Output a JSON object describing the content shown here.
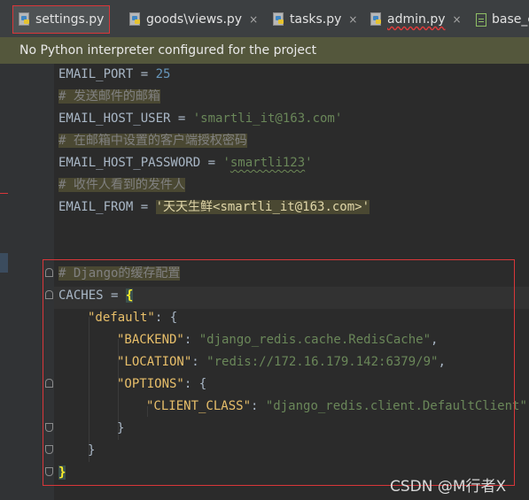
{
  "tabs": [
    {
      "label": "settings.py",
      "active": true,
      "close": ""
    },
    {
      "label": "goods\\views.py",
      "active": false,
      "close": "×"
    },
    {
      "label": "tasks.py",
      "active": false,
      "close": "×"
    },
    {
      "label": "admin.py",
      "active": false,
      "close": "×"
    },
    {
      "label": "base_c",
      "active": false,
      "close": ""
    }
  ],
  "banner": {
    "text": "No Python interpreter configured for the project"
  },
  "code": {
    "email_port_name": "EMAIL_PORT = ",
    "email_port_value": "25",
    "comment1": "# 发送邮件的邮箱",
    "email_host_user_name": "EMAIL_HOST_USER = ",
    "email_host_user_value": "'smartli_it@163.com'",
    "comment2": "# 在邮箱中设置的客户端授权密码",
    "email_host_password_name": "EMAIL_HOST_PASSWORD = ",
    "email_host_password_q1": "'",
    "email_host_password_value": "smartli123",
    "email_host_password_q2": "'",
    "comment3": "# 收件人看到的发件人",
    "email_from_name": "EMAIL_FROM = ",
    "email_from_q1": "'",
    "email_from_cn": "天天生鲜",
    "email_from_rest": "<smartli_it@163.com>",
    "email_from_q2": "'",
    "comment4": "# Django的缓存配置",
    "caches_name": "CACHES = ",
    "caches_open": "{",
    "default_key": "\"default\"",
    "default_rest": ": {",
    "backend_key": "\"BACKEND\"",
    "backend_colon": ": ",
    "backend_value": "\"django_redis.cache.RedisCache\"",
    "backend_comma": ",",
    "location_key": "\"LOCATION\"",
    "location_colon": ": ",
    "location_value": "\"redis://172.16.179.142:6379/9\"",
    "location_comma": ",",
    "options_key": "\"OPTIONS\"",
    "options_rest": ": {",
    "client_class_key": "\"CLIENT_CLASS\"",
    "client_class_colon": ": ",
    "client_class_value": "\"django_redis.client.DefaultClient\"",
    "client_class_comma": ",",
    "close_inner": "}",
    "close_default": "}",
    "close_caches": "}"
  },
  "watermark": "CSDN @M行者X"
}
